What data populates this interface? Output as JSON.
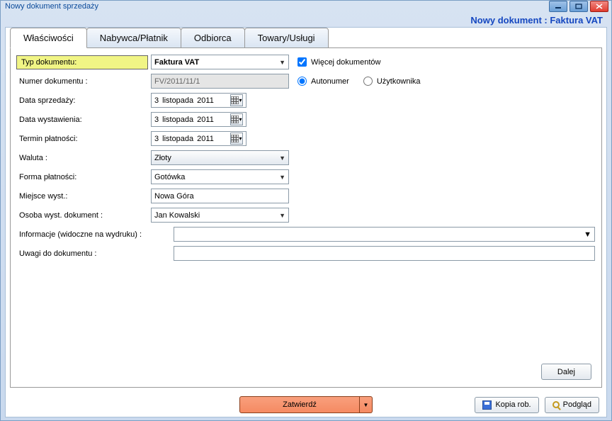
{
  "window": {
    "title": "Nowy dokument sprzedaży",
    "subheader": "Nowy dokument : Faktura VAT"
  },
  "tabs": [
    {
      "label": "Właściwości",
      "active": true
    },
    {
      "label": "Nabywca/Płatnik",
      "active": false
    },
    {
      "label": "Odbiorca",
      "active": false
    },
    {
      "label": "Towary/Usługi",
      "active": false
    }
  ],
  "fields": {
    "typ_dokumentu": {
      "label": "Typ dokumentu:",
      "value": "Faktura VAT"
    },
    "wiecej": {
      "label": "Więcej dokumentów",
      "checked": true
    },
    "numer": {
      "label": "Numer dokumentu :",
      "value": "FV/2011/11/1"
    },
    "autonumer": {
      "label": "Autonumer",
      "selected": true
    },
    "uzytkownika": {
      "label": "Użytkownika",
      "selected": false
    },
    "data_sprzedazy": {
      "label": "Data sprzedaży:",
      "day": "3",
      "month": "listopada",
      "year": "2011"
    },
    "data_wystawienia": {
      "label": "Data wystawienia:",
      "day": "3",
      "month": "listopada",
      "year": "2011"
    },
    "termin_platnosci": {
      "label": "Termin płatności:",
      "day": "3",
      "month": "listopada",
      "year": "2011"
    },
    "waluta": {
      "label": "Waluta :",
      "value": "Złoty"
    },
    "forma_platnosci": {
      "label": "Forma płatności:",
      "value": "Gotówka"
    },
    "miejsce_wyst": {
      "label": "Miejsce wyst.:",
      "value": "Nowa Góra"
    },
    "osoba_wyst": {
      "label": "Osoba wyst. dokument :",
      "value": "Jan Kowalski"
    },
    "informacje": {
      "label": "Informacje (widoczne na wydruku) :",
      "value": ""
    },
    "uwagi": {
      "label": "Uwagi do dokumentu :",
      "value": ""
    }
  },
  "buttons": {
    "dalej": "Dalej",
    "zatwierdz": "Zatwierdź",
    "kopia": "Kopia rob.",
    "podglad": "Podgląd"
  }
}
